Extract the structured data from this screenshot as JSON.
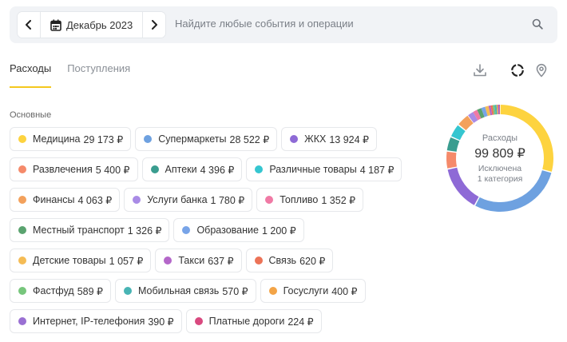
{
  "header": {
    "period": "Декабрь 2023",
    "search_placeholder": "Найдите любые события и операции"
  },
  "tabs": [
    {
      "label": "Расходы",
      "active": true
    },
    {
      "label": "Поступления",
      "active": false
    }
  ],
  "section_title": "Основные",
  "categories": [
    {
      "name": "Медицина",
      "amount": "29 173 ₽",
      "value": 29173,
      "color": "#fdd33f"
    },
    {
      "name": "Супермаркеты",
      "amount": "28 522 ₽",
      "value": 28522,
      "color": "#6ea1e0"
    },
    {
      "name": "ЖКХ",
      "amount": "13 924 ₽",
      "value": 13924,
      "color": "#8e6ad6"
    },
    {
      "name": "Развлечения",
      "amount": "5 400 ₽",
      "value": 5400,
      "color": "#f58a6a"
    },
    {
      "name": "Аптеки",
      "amount": "4 396 ₽",
      "value": 4396,
      "color": "#3a9d8f"
    },
    {
      "name": "Различные товары",
      "amount": "4 187 ₽",
      "value": 4187,
      "color": "#35c6d0"
    },
    {
      "name": "Финансы",
      "amount": "4 063 ₽",
      "value": 4063,
      "color": "#f3a15c"
    },
    {
      "name": "Услуги банка",
      "amount": "1 780 ₽",
      "value": 1780,
      "color": "#a98be6"
    },
    {
      "name": "Топливо",
      "amount": "1 352 ₽",
      "value": 1352,
      "color": "#f07aa5"
    },
    {
      "name": "Местный транспорт",
      "amount": "1 326 ₽",
      "value": 1326,
      "color": "#5aa36f"
    },
    {
      "name": "Образование",
      "amount": "1 200 ₽",
      "value": 1200,
      "color": "#78a4e8"
    },
    {
      "name": "Детские товары",
      "amount": "1 057 ₽",
      "value": 1057,
      "color": "#f5bc55"
    },
    {
      "name": "Такси",
      "amount": "637 ₽",
      "value": 637,
      "color": "#b467c9"
    },
    {
      "name": "Связь",
      "amount": "620 ₽",
      "value": 620,
      "color": "#ec7357"
    },
    {
      "name": "Фастфуд",
      "amount": "589 ₽",
      "value": 589,
      "color": "#77c67c"
    },
    {
      "name": "Мобильная связь",
      "amount": "570 ₽",
      "value": 570,
      "color": "#48b4b4"
    },
    {
      "name": "Госуслуги",
      "amount": "400 ₽",
      "value": 400,
      "color": "#f3a447"
    },
    {
      "name": "Интернет, IP-телефония",
      "amount": "390 ₽",
      "value": 390,
      "color": "#9a70d3"
    },
    {
      "name": "Платные дороги",
      "amount": "224 ₽",
      "value": 224,
      "color": "#d9497f"
    }
  ],
  "summary": {
    "label": "Расходы",
    "total": "99 809 ₽",
    "excluded_line1": "Исключена",
    "excluded_line2": "1 категория"
  },
  "icons": {
    "prev": "chevron-left-icon",
    "next": "chevron-right-icon",
    "calendar": "calendar-icon",
    "search": "search-icon",
    "download": "download-icon",
    "donut": "donut-chart-icon",
    "location": "location-pin-icon"
  }
}
